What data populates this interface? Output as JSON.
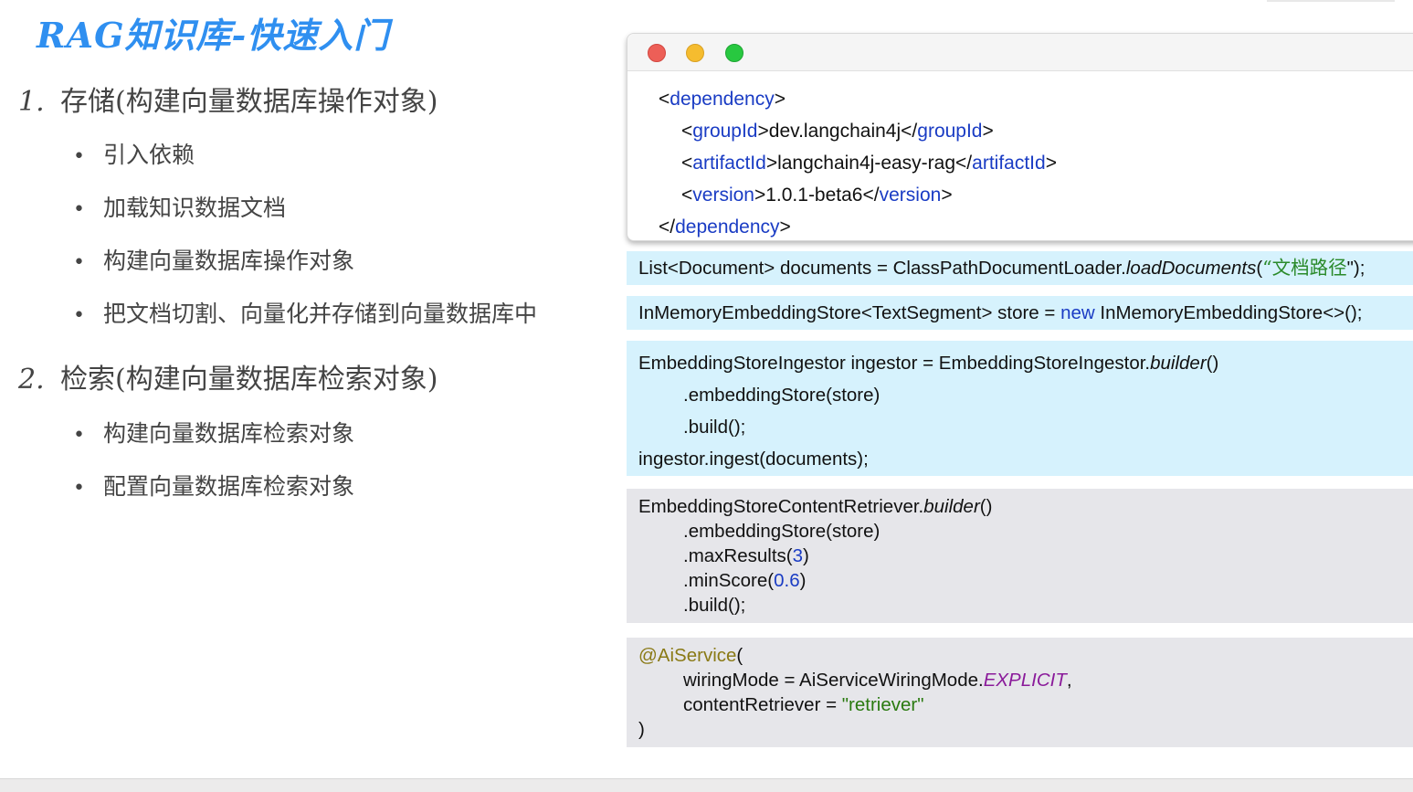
{
  "title": "RAG知识库-快速入门",
  "sections": [
    {
      "num": "1.",
      "label": "存储(构建向量数据库操作对象)",
      "bullets": [
        "引入依赖",
        "加载知识数据文档",
        "构建向量数据库操作对象",
        "把文档切割、向量化并存储到向量数据库中"
      ]
    },
    {
      "num": "2.",
      "label": "检索(构建向量数据库检索对象)",
      "bullets": [
        "构建向量数据库检索对象",
        "配置向量数据库检索对象"
      ]
    }
  ],
  "bullet_glyph": "•",
  "xml": {
    "dep_open_tag": "dependency",
    "group_tag": "groupId",
    "group_val": "dev.langchain4j",
    "artifact_tag": "artifactId",
    "artifact_val": "langchain4j-easy-rag",
    "version_tag": "version",
    "version_val": "1.0.1-beta6",
    "dep_close_tag": "dependency"
  },
  "code1": {
    "a": "List<Document> documents = ClassPathDocumentLoader.",
    "method": "loadDocuments",
    "b": "(",
    "str": "“文档路径",
    "c": "\");"
  },
  "code2": {
    "a": "InMemoryEmbeddingStore<TextSegment> store = ",
    "kw": "new",
    "b": " InMemoryEmbeddingStore<>();"
  },
  "code3": {
    "l1a": "EmbeddingStoreIngestor ingestor = EmbeddingStoreIngestor.",
    "l1m": "builder",
    "l1b": "()",
    "l2": ".embeddingStore(store)",
    "l3": ".build();",
    "l4": "ingestor.ingest(documents);"
  },
  "code4": {
    "l1a": "EmbeddingStoreContentRetriever.",
    "l1m": "builder",
    "l1b": "()",
    "l2": ".embeddingStore(store)",
    "l3a": ".maxResults(",
    "l3n": "3",
    "l3b": ")",
    "l4a": ".minScore(",
    "l4n": "0.6",
    "l4b": ")",
    "l5": ".build();"
  },
  "code5": {
    "ann": "@AiService",
    "open": "(",
    "l2a": "wiringMode = AiServiceWiringMode.",
    "l2e": "EXPLICIT",
    "l2b": ",",
    "l3a": "contentRetriever = ",
    "l3s": "\"retriever\"",
    "close": ")"
  },
  "colors": {
    "title": "#2f8ff0",
    "tag": "#1a3cc4",
    "cyan_block": "#d6f2fd",
    "gray_block": "#e6e6ea",
    "annotation": "#8a7a16",
    "enum": "#8a1a9a",
    "string": "#2a7a10"
  },
  "icons": [
    "window-close-light",
    "window-minimize-light",
    "window-zoom-light"
  ]
}
